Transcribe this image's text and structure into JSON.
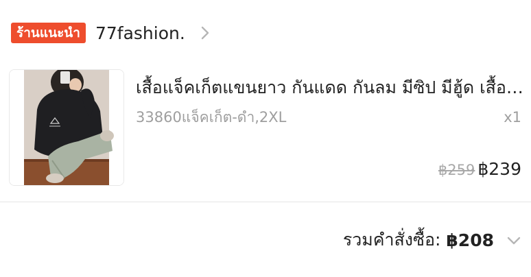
{
  "shop": {
    "badge": "ร้านแนะนำ",
    "name": "77fashion."
  },
  "product": {
    "title": "เสื้อแจ็คเก็ตแขนยาว กันแดด กันลม มีซิป มีฮู้ด เสื้อคลุม",
    "variation": "33860แจ็คเก็ต-ดำ,2XL",
    "quantity": "x1",
    "original_price": "฿259",
    "price": "฿239"
  },
  "order_total": {
    "label": "รวมคำสั่งซื้อ:",
    "amount": "฿208"
  },
  "colors": {
    "accent": "#ee4d2d"
  },
  "icons": {
    "shop_chevron": "chevron-right-icon",
    "total_chevron": "chevron-down-icon"
  }
}
